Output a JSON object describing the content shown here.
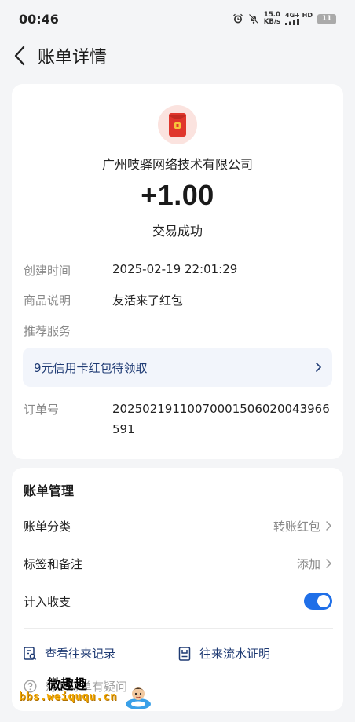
{
  "status_bar": {
    "time": "00:46",
    "net_speed": "15.0",
    "net_unit": "KB/s",
    "signal_label": "4G+ HD",
    "battery": "11"
  },
  "header": {
    "title": "账单详情"
  },
  "transaction": {
    "merchant": "广州吱驿网络技术有限公司",
    "amount": "+1.00",
    "status": "交易成功",
    "details": [
      {
        "label": "创建时间",
        "value": "2025-02-19 22:01:29"
      },
      {
        "label": "商品说明",
        "value": "友活来了红包"
      },
      {
        "label": "推荐服务",
        "value": ""
      }
    ],
    "promo": "9元信用卡红包待领取",
    "order_label": "订单号",
    "order_value": "20250219110070001506020043966591"
  },
  "management": {
    "title": "账单管理",
    "category_label": "账单分类",
    "category_value": "转账红包",
    "tags_label": "标签和备注",
    "tags_value": "添加",
    "count_label": "计入收支",
    "count_enabled": true,
    "history_link": "查看往来记录",
    "statement_link": "往来流水证明",
    "faq_link": "对此订单有疑问"
  },
  "watermark": {
    "top": "微趣趣",
    "bottom": "bbs.weiququ.cn"
  },
  "colors": {
    "accent": "#1f6fe8",
    "link": "#1e3a73",
    "red_packet": "#e0362c"
  }
}
